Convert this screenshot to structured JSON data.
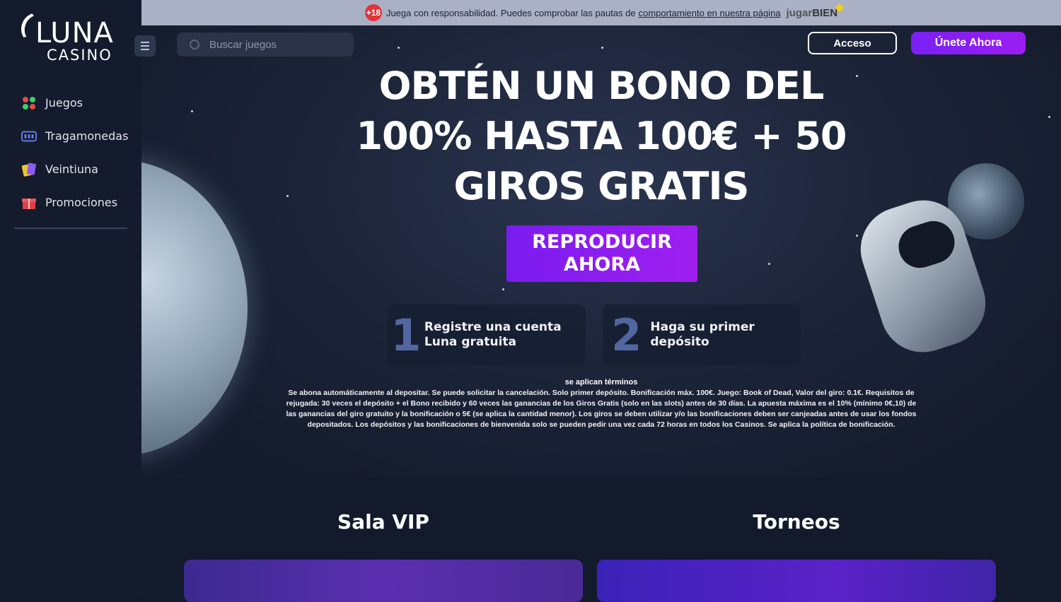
{
  "brand": {
    "name": "LUNA",
    "sub": "CASINO"
  },
  "sidebar": {
    "items": [
      {
        "label": "Juegos",
        "icon": "cards-icon"
      },
      {
        "label": "Tragamonedas",
        "icon": "slot-machine-icon"
      },
      {
        "label": "Veintiuna",
        "icon": "blackjack-icon"
      },
      {
        "label": "Promociones",
        "icon": "gift-icon"
      }
    ]
  },
  "topbar": {
    "age": "+18",
    "text": "Juega con responsabilidad. Puedes comprobar las pautas de",
    "link": "comportamiento en nuestra página",
    "logo_a": "jugar",
    "logo_b": "BIEN"
  },
  "search": {
    "placeholder": "Buscar juegos"
  },
  "header": {
    "login": "Acceso",
    "join": "Únete Ahora"
  },
  "hero": {
    "headline": "OBTÉN UN BONO DEL 100% HASTA 100€ + 50 GIROS GRATIS",
    "cta": "REPRODUCIR AHORA",
    "steps": [
      {
        "num": "1",
        "text": "Registre una cuenta Luna gratuita"
      },
      {
        "num": "2",
        "text": "Haga su primer depósito"
      }
    ],
    "terms_title": "se aplican términos",
    "terms": "Se abona automáticamente al depositar. Se puede solicitar la cancelación. Solo primer depósito. Bonificación máx. 100€. Juego: Book of Dead, Valor del giro: 0.1€. Requisitos de rejugada: 30 veces el depósito + el Bono recibido y 60 veces las ganancias de los Giros Gratis (solo en las slots) antes de 30 días. La apuesta máxima es el 10% (mínimo 0€,10) de las ganancias del giro gratuito y la bonificación o 5€ (se aplica la cantidad menor). Los giros se deben utilizar y/o las bonificaciones deben ser canjeadas antes de usar los fondos depositados. Los depósitos y las bonificaciones de bienvenida solo se pueden pedir una vez cada 72 horas en todos los Casinos. Se aplica la política de bonificación."
  },
  "sections": [
    {
      "title": "Sala VIP"
    },
    {
      "title": "Torneos"
    }
  ],
  "colors": {
    "accent": "#8b1ff2",
    "sidebar": "#141b2c",
    "topbar": "#aab1c4"
  }
}
